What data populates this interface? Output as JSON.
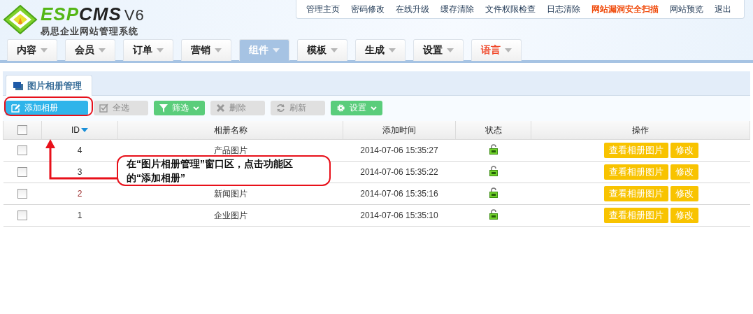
{
  "logo": {
    "brand_prefix": "ESP",
    "brand_suffix": "CMS",
    "version": "V6",
    "subtitle": "易思企业网站管理系统"
  },
  "top_links": [
    {
      "label": "管理主页",
      "highlight": false
    },
    {
      "label": "密码修改",
      "highlight": false
    },
    {
      "label": "在线升级",
      "highlight": false
    },
    {
      "label": "缓存清除",
      "highlight": false
    },
    {
      "label": "文件权限检查",
      "highlight": false
    },
    {
      "label": "日志清除",
      "highlight": false
    },
    {
      "label": "网站漏洞安全扫描",
      "highlight": true
    },
    {
      "label": "网站预览",
      "highlight": false
    },
    {
      "label": "退出",
      "highlight": false
    }
  ],
  "nav": [
    {
      "label": "内容",
      "selected": false,
      "highlight": false
    },
    {
      "label": "会员",
      "selected": false,
      "highlight": false
    },
    {
      "label": "订单",
      "selected": false,
      "highlight": false
    },
    {
      "label": "营销",
      "selected": false,
      "highlight": false
    },
    {
      "label": "组件",
      "selected": true,
      "highlight": false
    },
    {
      "label": "模板",
      "selected": false,
      "highlight": false
    },
    {
      "label": "生成",
      "selected": false,
      "highlight": false
    },
    {
      "label": "设置",
      "selected": false,
      "highlight": false
    },
    {
      "label": "语言",
      "selected": false,
      "highlight": true
    }
  ],
  "panel_tab": {
    "label": "图片相册管理",
    "selected": true
  },
  "toolbar": [
    {
      "label": "添加相册",
      "kind": "primary",
      "dropdown": false
    },
    {
      "label": "全选",
      "kind": "default",
      "dropdown": false
    },
    {
      "label": "筛选",
      "kind": "green",
      "dropdown": true
    },
    {
      "label": "删除",
      "kind": "default",
      "dropdown": false
    },
    {
      "label": "刷新",
      "kind": "default",
      "dropdown": false
    },
    {
      "label": "设置",
      "kind": "green",
      "dropdown": true
    }
  ],
  "table": {
    "select_all": {
      "checked": false
    },
    "columns": [
      {
        "label": "ID",
        "sorted": true
      },
      {
        "label": "相册名称",
        "sorted": false
      },
      {
        "label": "添加时间",
        "sorted": false
      },
      {
        "label": "状态",
        "sorted": false
      },
      {
        "label": "操作",
        "sorted": false
      }
    ],
    "rows": [
      {
        "checked": false,
        "id": "4",
        "name": "产品图片",
        "time": "2014-07-06 15:35:27",
        "locked": false,
        "actions": [
          "查看相册图片",
          "修改"
        ]
      },
      {
        "checked": false,
        "id": "3",
        "time": "2014-07-06 15:35:22",
        "locked": false,
        "actions": [
          "查看相册图片",
          "修改"
        ]
      },
      {
        "checked": false,
        "id": "2",
        "name": "新闻图片",
        "time": "2014-07-06 15:35:16",
        "locked": false,
        "actions": [
          "查看相册图片",
          "修改"
        ]
      },
      {
        "checked": false,
        "id": "1",
        "name": "企业图片",
        "time": "2014-07-06 15:35:10",
        "locked": false,
        "actions": [
          "查看相册图片",
          "修改"
        ]
      }
    ]
  },
  "callout": {
    "text": "在“图片相册管理”窗口区，点击功能区的“添加相册”"
  }
}
